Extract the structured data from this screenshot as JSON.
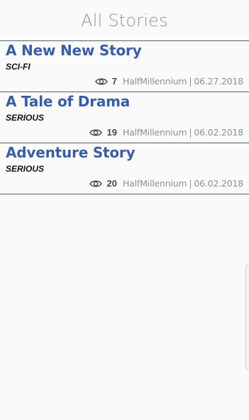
{
  "header": {
    "title": "All Stories"
  },
  "stories": [
    {
      "title": "A New New Story",
      "genre": "SCI-FI",
      "views": "7",
      "author": "HalfMillennium",
      "separator": "|",
      "date": "06.27.2018"
    },
    {
      "title": "A Tale of Drama",
      "genre": "SERIOUS",
      "views": "19",
      "author": "HalfMillennium",
      "separator": "|",
      "date": "06.02.2018"
    },
    {
      "title": "Adventure Story",
      "genre": "SERIOUS",
      "views": "20",
      "author": "HalfMillennium",
      "separator": "|",
      "date": "06.02.2018"
    }
  ],
  "colors": {
    "title_blue": "#3a5ea3",
    "divider": "#55606b",
    "muted_text": "#8c9297",
    "header_text": "#8e9499"
  },
  "icons": {
    "views": "eye-icon"
  }
}
